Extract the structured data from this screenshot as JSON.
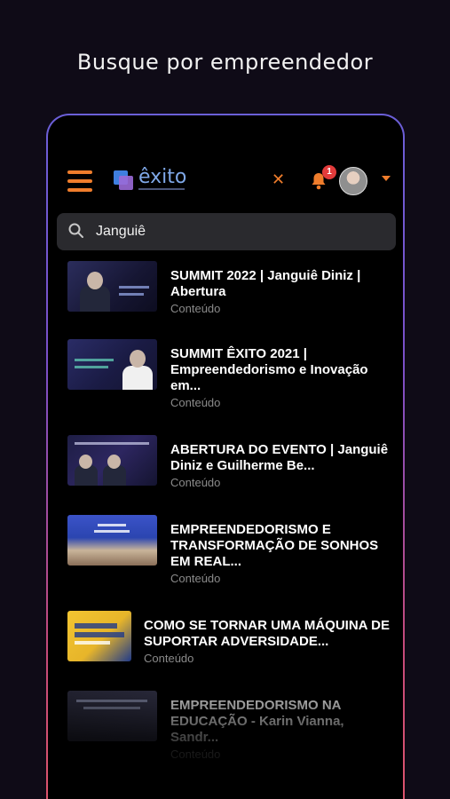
{
  "headline": "Busque por empreendedor",
  "appbar": {
    "logo_text": "êxito",
    "close_glyph": "✕",
    "notification_count": "1",
    "colors": {
      "accent": "#ef7d2c",
      "badge": "#e23b3b",
      "logo": "#7fa8e8"
    }
  },
  "search": {
    "value": "Janguiê",
    "placeholder": "Buscar"
  },
  "results": [
    {
      "title": "SUMMIT 2022 | Janguiê Diniz | Abertura",
      "type": "Conteúdo",
      "thumb": "summit-2022-abertura"
    },
    {
      "title": "SUMMIT ÊXITO 2021 | Empreendedorismo e Inovação em...",
      "type": "Conteúdo",
      "thumb": "summit-exito-2021"
    },
    {
      "title": "ABERTURA DO EVENTO | Janguiê Diniz e Guilherme Be...",
      "type": "Conteúdo",
      "thumb": "abertura-do-evento"
    },
    {
      "title": "EMPREENDEDORISMO E TRANSFORMAÇÃO DE SONHOS EM REAL...",
      "type": "Conteúdo",
      "thumb": "facing-the-giants"
    },
    {
      "title": "COMO SE TORNAR UMA MÁQUINA DE SUPORTAR ADVERSIDADE...",
      "type": "Conteúdo",
      "thumb": "instituto-exito-summit"
    },
    {
      "title": "EMPREENDEDORISMO NA EDUCAÇÃO - Karin Vianna, Sandr...",
      "type": "Conteúdo",
      "thumb": "educacao-panel"
    }
  ]
}
